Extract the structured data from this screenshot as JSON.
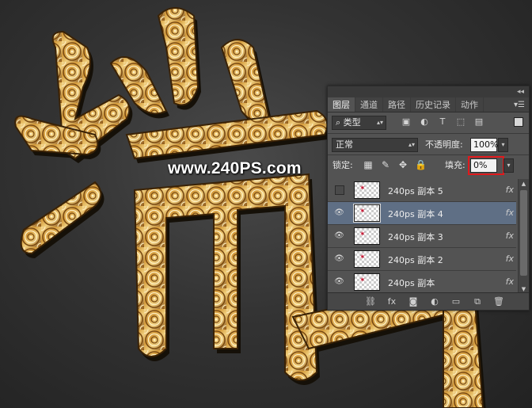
{
  "watermark": "www.240PS.com",
  "colors": {
    "gold_light": "#f3d68a",
    "gold_mid": "#c98e2c",
    "gold_dark": "#6a3e0c",
    "selection": "#5f6f85",
    "highlight": "#e0191c"
  },
  "panel": {
    "collapse_icon": "double-chevron-icon",
    "menu_icon": "panel-menu-icon",
    "tabs": [
      {
        "label": "图层",
        "active": true
      },
      {
        "label": "通道",
        "active": false
      },
      {
        "label": "路径",
        "active": false
      },
      {
        "label": "历史记录",
        "active": false
      },
      {
        "label": "动作",
        "active": false
      }
    ],
    "filter": {
      "search_glyph": "⌕",
      "label": "类型"
    },
    "blend": {
      "mode": "正常",
      "opacity_label": "不透明度:",
      "opacity_value": "100%"
    },
    "lock": {
      "label": "锁定:",
      "fill_label": "填充:",
      "fill_value": "0%"
    },
    "layers": [
      {
        "name": "240ps  副本 5",
        "visible": false,
        "selected": false,
        "fx": "fx"
      },
      {
        "name": "240ps  副本 4",
        "visible": true,
        "selected": true,
        "fx": "fx"
      },
      {
        "name": "240ps  副本 3",
        "visible": true,
        "selected": false,
        "fx": "fx"
      },
      {
        "name": "240ps  副本 2",
        "visible": true,
        "selected": false,
        "fx": "fx"
      },
      {
        "name": "240ps  副本",
        "visible": true,
        "selected": false,
        "fx": "fx"
      }
    ],
    "footer_fx": "fx"
  }
}
